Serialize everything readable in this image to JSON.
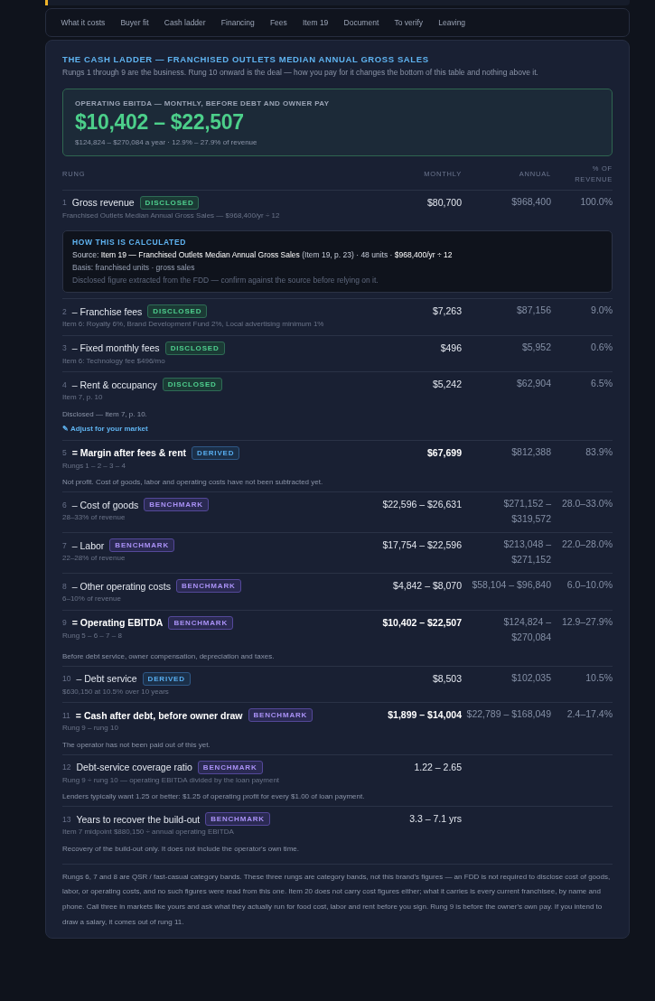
{
  "tabs": [
    {
      "label": "What it costs",
      "selected": false
    },
    {
      "label": "Buyer fit",
      "selected": false
    },
    {
      "label": "Cash ladder",
      "selected": false
    },
    {
      "label": "Financing",
      "selected": false
    },
    {
      "label": "Fees",
      "selected": false
    },
    {
      "label": "Item 19",
      "selected": false
    },
    {
      "label": "Document",
      "selected": false
    },
    {
      "label": "To verify",
      "selected": false
    },
    {
      "label": "Leaving",
      "selected": false
    }
  ],
  "section": {
    "title": "THE CASH LADDER — FRANCHISED OUTLETS MEDIAN ANNUAL GROSS SALES",
    "intro": "Rungs 1 through 9 are the business. Rung 10 onward is the deal — how you pay for it changes the bottom of this table and nothing above it.",
    "summary": {
      "label": "OPERATING EBITDA — MONTHLY, BEFORE DEBT AND OWNER PAY",
      "value": "$10,402 – $22,507",
      "detail": "$124,824 – $270,084 a year · 12.9% – 27.9% of revenue"
    },
    "table": {
      "columns": [
        "RUNG",
        "MONTHLY",
        "ANNUAL",
        "% OF REVENUE"
      ],
      "rows": [
        {
          "number": "1",
          "kind": "line",
          "label": "Gross revenue",
          "badge": {
            "label": "DISCLOSED",
            "kind": "disclosed"
          },
          "source": "Franchised Outlets Median Annual Gross Sales — $968,400/yr ÷ 12",
          "monthly": "$80,700",
          "annual": "$968,400",
          "share": "100.0%",
          "calculation": {
            "title": "HOW THIS IS CALCULATED",
            "source": "Source: **Item 19 — Franchised Outlets Median Annual Gross Sales** (Item 19, p. 23) · 48 units · **$968,400/yr ÷ 12**",
            "basis": "Basis: franchised units · gross sales",
            "caveat": "Disclosed figure extracted from the FDD — confirm against the source before relying on it."
          }
        },
        {
          "number": "2",
          "kind": "line",
          "label": "– Franchise fees",
          "badge": {
            "label": "DISCLOSED",
            "kind": "disclosed"
          },
          "source": "Item 6: Royalty 6%, Brand Development Fund 2%, Local advertising minimum 1%",
          "monthly": "$7,263",
          "annual": "$87,156",
          "share": "9.0%"
        },
        {
          "number": "3",
          "kind": "line",
          "label": "– Fixed monthly fees",
          "badge": {
            "label": "DISCLOSED",
            "kind": "disclosed"
          },
          "source": "Item 6: Technology fee $496/mo",
          "monthly": "$496",
          "annual": "$5,952",
          "share": "0.6%"
        },
        {
          "number": "4",
          "kind": "line",
          "label": "– Rent & occupancy",
          "badge": {
            "label": "DISCLOSED",
            "kind": "disclosed"
          },
          "source": "Item 7, p. 10",
          "monthly": "$5,242",
          "annual": "$62,904",
          "share": "6.5%",
          "note": "Disclosed — Item 7, p. 10.",
          "link": "✎ Adjust for your market"
        },
        {
          "number": "5",
          "kind": "total",
          "label": "= Margin after fees & rent",
          "badge": {
            "label": "DERIVED",
            "kind": "derived"
          },
          "source": "Rungs 1 – 2 – 3 – 4",
          "monthly": "$67,699",
          "annual": "$812,388",
          "share": "83.9%",
          "note": "Not profit. Cost of goods, labor and operating costs have not been subtracted yet."
        },
        {
          "number": "6",
          "kind": "line",
          "label": "– Cost of goods",
          "badge": {
            "label": "BENCHMARK",
            "kind": "benchmark"
          },
          "source": "28–33% of revenue",
          "monthly": "$22,596 – $26,631",
          "annual": "$271,152 – $319,572",
          "share": "28.0–33.0%"
        },
        {
          "number": "7",
          "kind": "line",
          "label": "– Labor",
          "badge": {
            "label": "BENCHMARK",
            "kind": "benchmark"
          },
          "source": "22–28% of revenue",
          "monthly": "$17,754 – $22,596",
          "annual": "$213,048 – $271,152",
          "share": "22.0–28.0%"
        },
        {
          "number": "8",
          "kind": "line",
          "label": "– Other operating costs",
          "badge": {
            "label": "BENCHMARK",
            "kind": "benchmark"
          },
          "source": "6–10% of revenue",
          "monthly": "$4,842 – $8,070",
          "annual": "$58,104 – $96,840",
          "share": "6.0–10.0%"
        },
        {
          "number": "9",
          "kind": "total",
          "label": "= Operating EBITDA",
          "badge": {
            "label": "BENCHMARK",
            "kind": "benchmark"
          },
          "source": "Rung 5 – 6 – 7 – 8",
          "monthly": "$10,402 – $22,507",
          "annual": "$124,824 – $270,084",
          "share": "12.9–27.9%",
          "note": "Before debt service, owner compensation, depreciation and taxes."
        },
        {
          "number": "10",
          "kind": "line",
          "label": "– Debt service",
          "badge": {
            "label": "DERIVED",
            "kind": "derived"
          },
          "source": "$630,150 at 10.5% over 10 years",
          "monthly": "$8,503",
          "annual": "$102,035",
          "share": "10.5%"
        },
        {
          "number": "11",
          "kind": "total",
          "label": "= Cash after debt, before owner draw",
          "badge": {
            "label": "BENCHMARK",
            "kind": "benchmark"
          },
          "source": "Rung 9 – rung 10",
          "monthly": "$1,899 – $14,004",
          "annual": "$22,789 – $168,049",
          "share": "2.4–17.4%",
          "note": "The operator has not been paid out of this yet."
        },
        {
          "number": "12",
          "kind": "line",
          "label": "Debt-service coverage ratio",
          "badge": {
            "label": "BENCHMARK",
            "kind": "benchmark"
          },
          "source": "Rung 9 ÷ rung 10 — operating EBITDA divided by the loan payment",
          "monthly": "1.22 – 2.65",
          "note": "Lenders typically want 1.25 or better: $1.25 of operating profit for every $1.00 of loan payment."
        },
        {
          "number": "13",
          "kind": "line",
          "label": "Years to recover the build-out",
          "badge": {
            "label": "BENCHMARK",
            "kind": "benchmark"
          },
          "source": "Item 7 midpoint $880,150 ÷ annual operating EBITDA",
          "monthly": "3.3 – 7.1 yrs",
          "note": "Recovery of the build-out only. It does not include the operator's own time."
        }
      ]
    },
    "footnote": "Rungs 6, 7 and 8 are QSR / fast-casual category bands. These three rungs are category bands, not this brand's figures — an FDD is not required to disclose cost of goods, labor, or operating costs, and no such figures were read from this one. Item 20 does not carry cost figures either; what it carries is every current franchisee, by name and phone. Call three in markets like yours and ask what they actually run for food cost, labor and rent before you sign. Rung 9 is before the owner's own pay. If you intend to draw a salary, it comes out of rung 11."
  }
}
